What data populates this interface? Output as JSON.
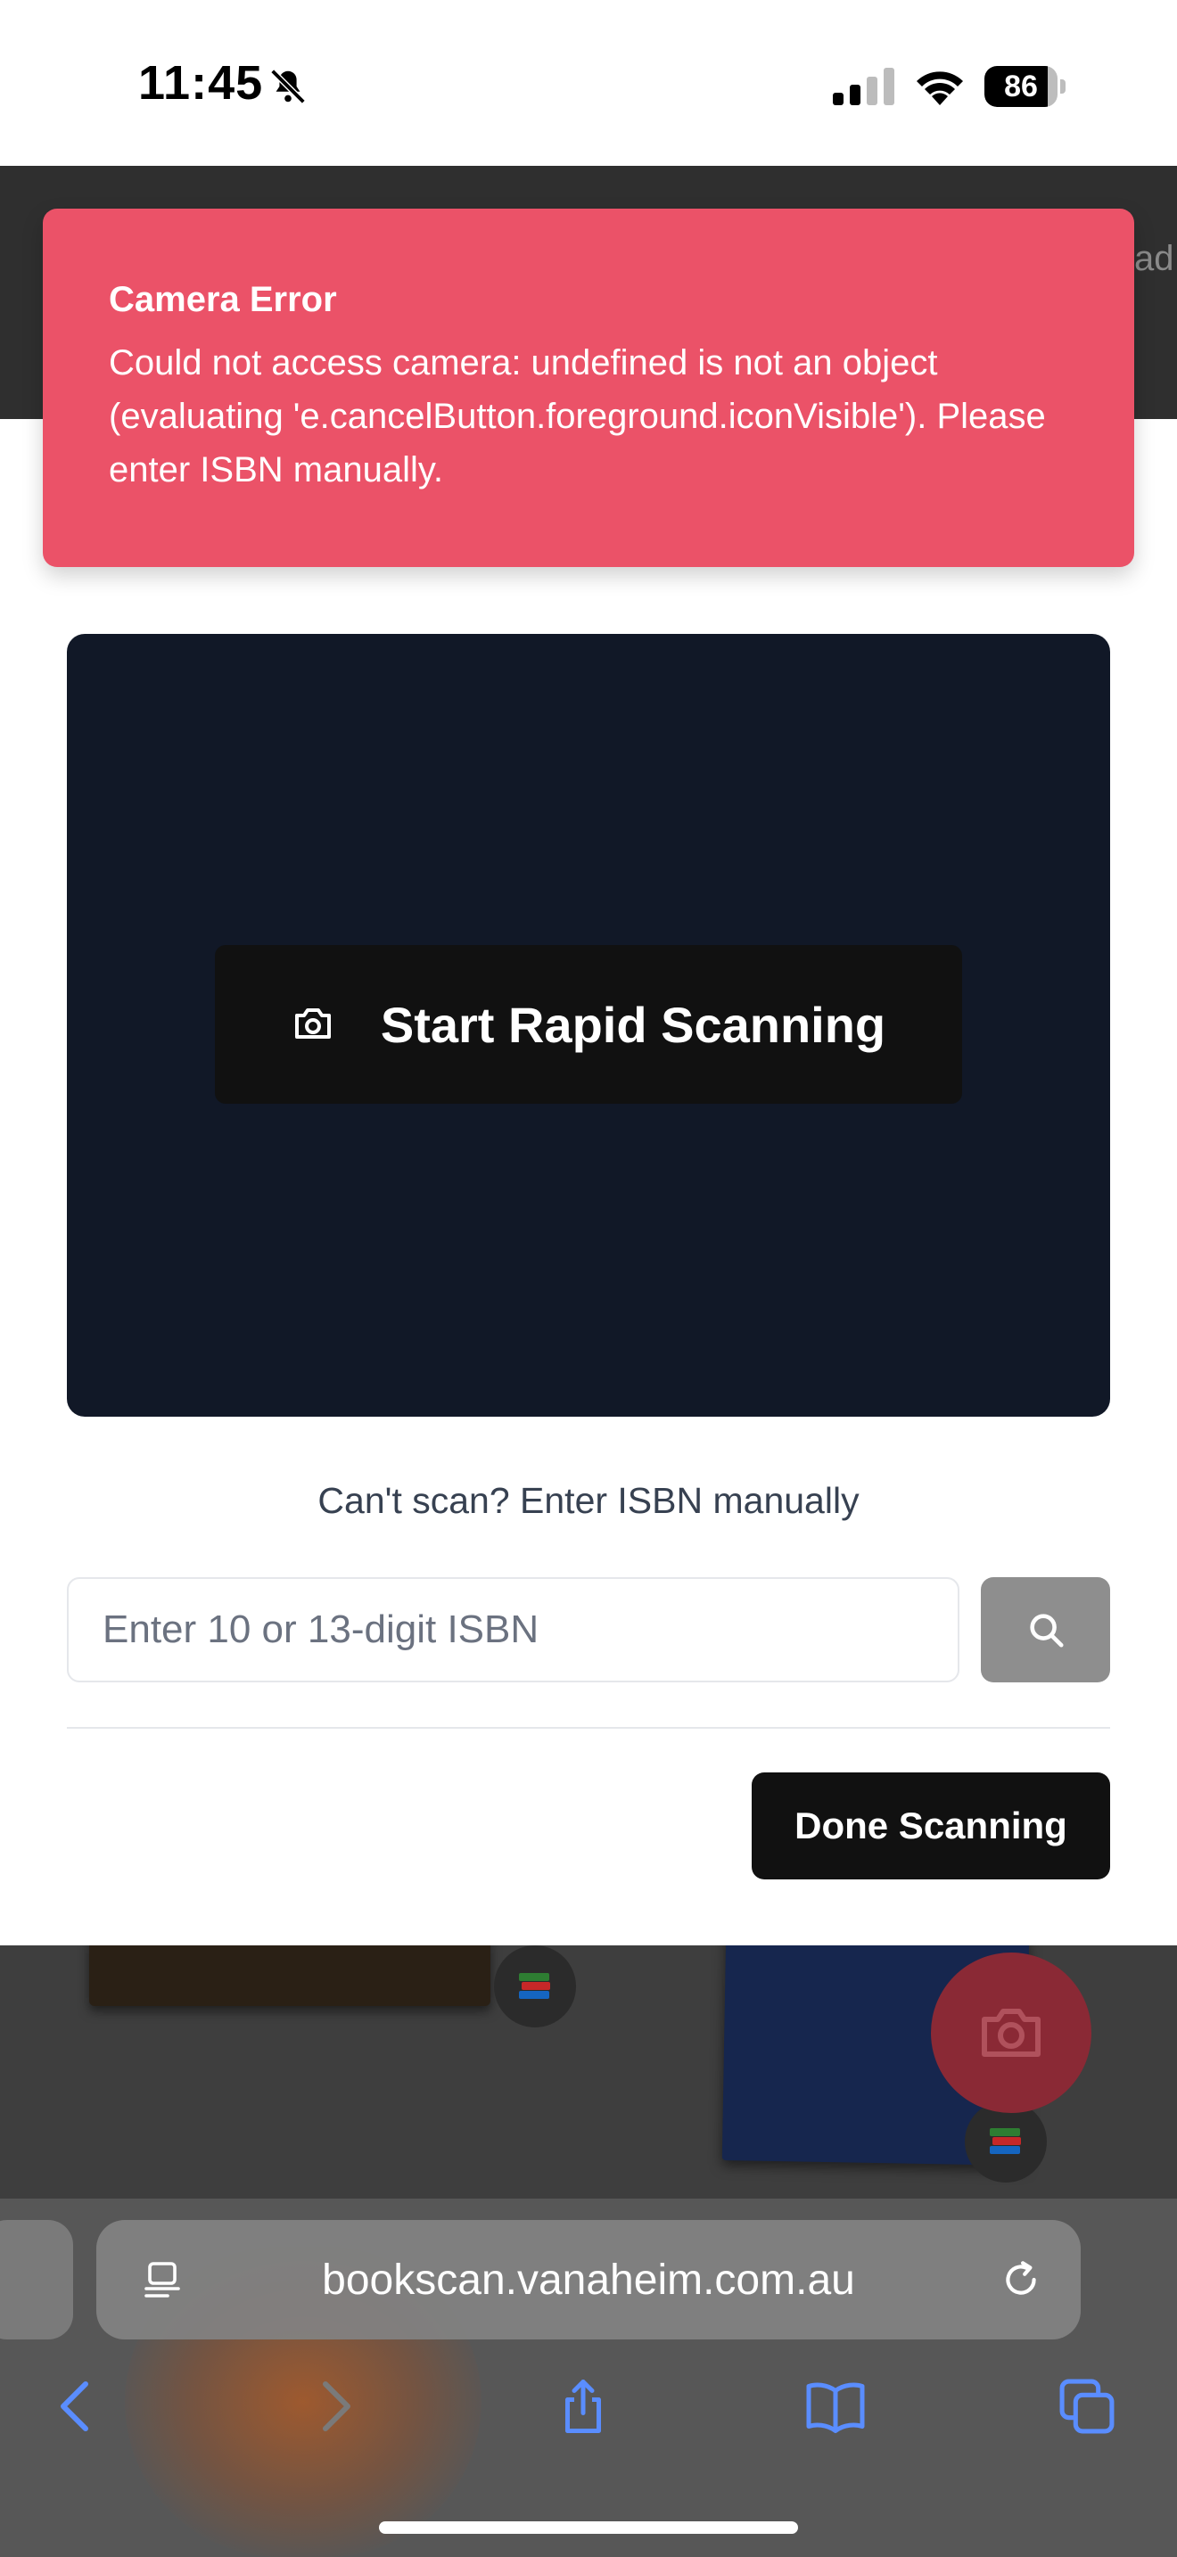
{
  "status_bar": {
    "time": "11:45",
    "battery_level": "86",
    "battery_fraction": 0.86
  },
  "background": {
    "header_text_fragment": "ad"
  },
  "toast": {
    "title": "Camera Error",
    "message": "Could not access camera: undefined is not an object (evaluating 'e.cancelButton.foreground.iconVisible'). Please enter ISBN manually.",
    "color": "#eb5268"
  },
  "scanner": {
    "start_label": "Start Rapid Scanning",
    "icon": "camera-icon",
    "color": "#111827"
  },
  "manual_entry": {
    "prompt": "Can't scan? Enter ISBN manually",
    "placeholder": "Enter 10 or 13-digit ISBN",
    "value": "",
    "search_icon": "search-icon"
  },
  "footer": {
    "done_label": "Done Scanning"
  },
  "browser": {
    "url": "bookscan.vanaheim.com.au",
    "toolbar_icons": [
      "back-icon",
      "forward-icon",
      "share-icon",
      "bookmarks-icon",
      "tabs-icon"
    ],
    "accent": "#5a8dff"
  }
}
